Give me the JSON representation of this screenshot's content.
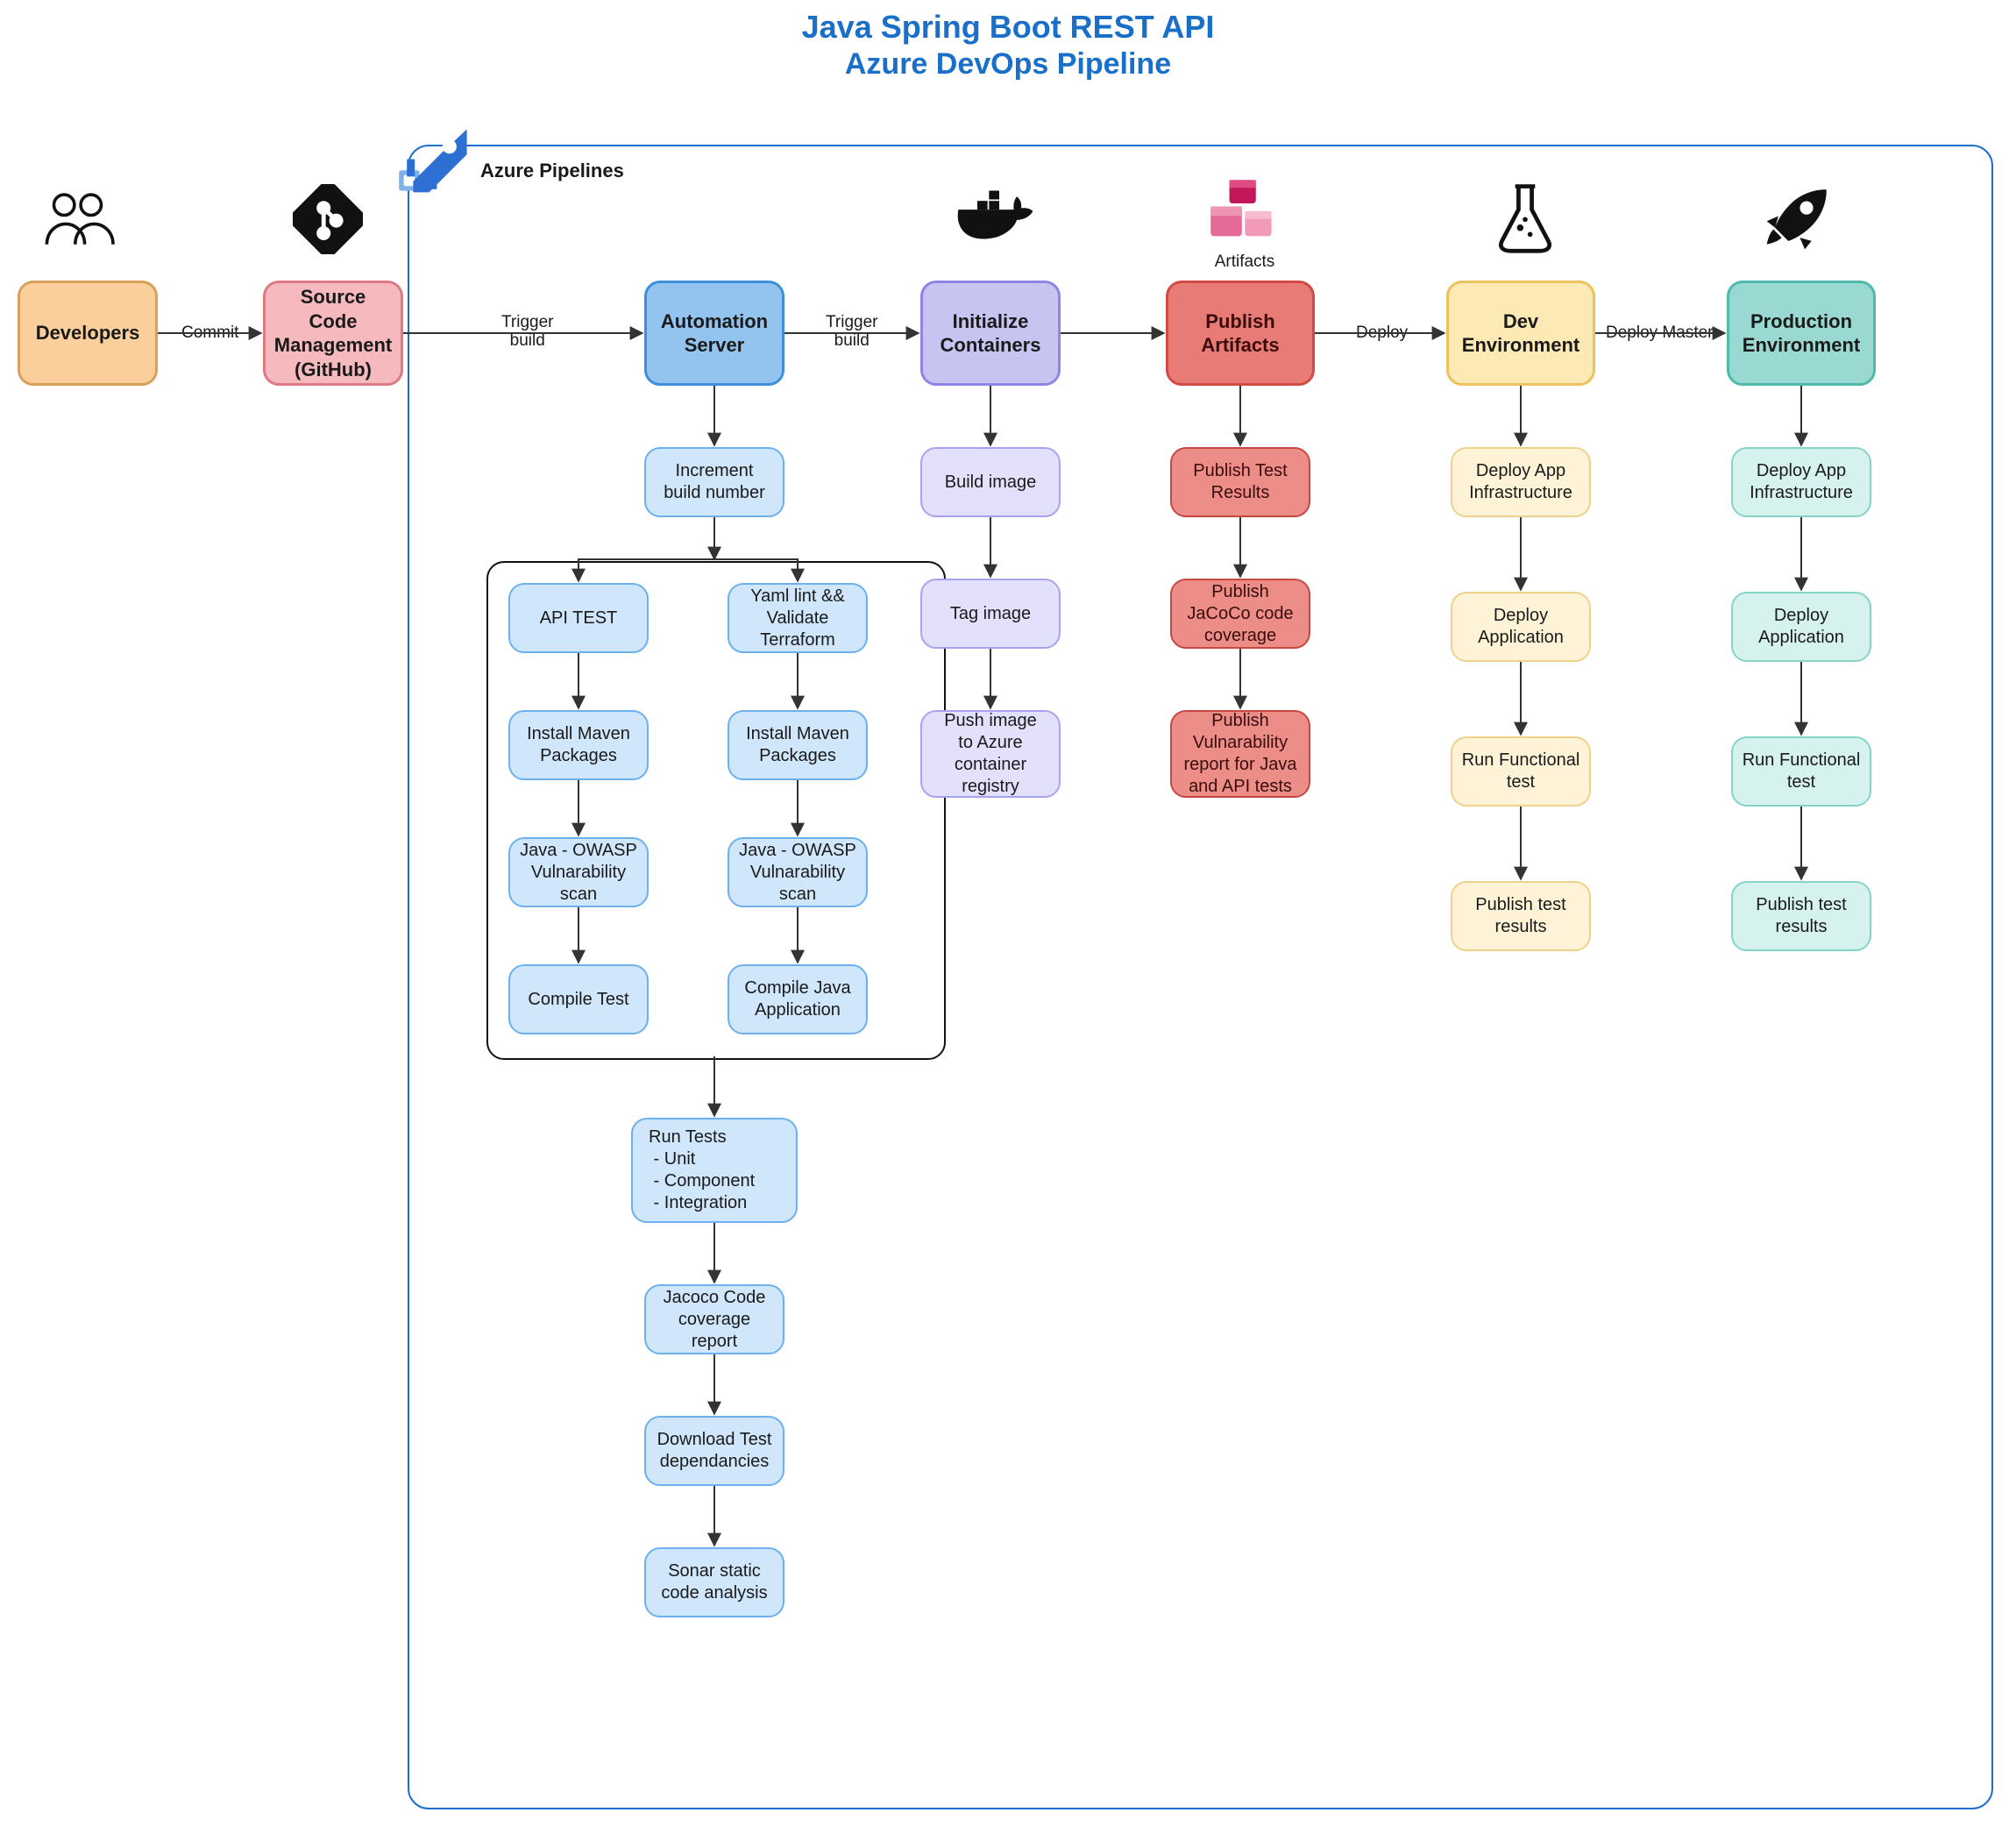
{
  "title": {
    "line1": "Java Spring Boot REST API",
    "line2": "Azure DevOps Pipeline"
  },
  "pipeline_label": "Azure Pipelines",
  "artifacts_label": "Artifacts",
  "edges": {
    "commit": "Commit",
    "trigger1": "Trigger\nbuild",
    "trigger2": "Trigger\nbuild",
    "deploy": "Deploy",
    "deploy_master": "Deploy Master"
  },
  "cols": {
    "dev": {
      "big": "Developers"
    },
    "git": {
      "big": "Source Code Management (GitHub)"
    },
    "auto": {
      "big": "Automation Server",
      "steps": [
        "Increment build number",
        "Run Tests\n - Unit\n - Component\n - Integration",
        "Jacoco Code coverage report",
        "Download Test dependancies",
        "Sonar static code analysis"
      ],
      "parallel_left": [
        "API TEST",
        "Install Maven Packages",
        "Java - OWASP Vulnarability scan",
        "Compile Test"
      ],
      "parallel_right": [
        "Yaml lint && Validate Terraform",
        "Install Maven Packages",
        "Java - OWASP Vulnarability scan",
        "Compile Java Application"
      ]
    },
    "init": {
      "big": "Initialize Containers",
      "steps": [
        "Build image",
        "Tag image",
        "Push image\nto Azure container registry"
      ]
    },
    "pub": {
      "big": "Publish Artifacts",
      "steps": [
        "Publish Test Results",
        "Publish JaCoCo code coverage",
        "Publish Vulnarability report for Java and API tests"
      ]
    },
    "devenv": {
      "big": "Dev Environment",
      "steps": [
        "Deploy App Infrastructure",
        "Deploy Application",
        "Run Functional test",
        "Publish test results"
      ]
    },
    "prod": {
      "big": "Production Environment",
      "steps": [
        "Deploy App Infrastructure",
        "Deploy Application",
        "Run Functional test",
        "Publish test results"
      ]
    }
  }
}
